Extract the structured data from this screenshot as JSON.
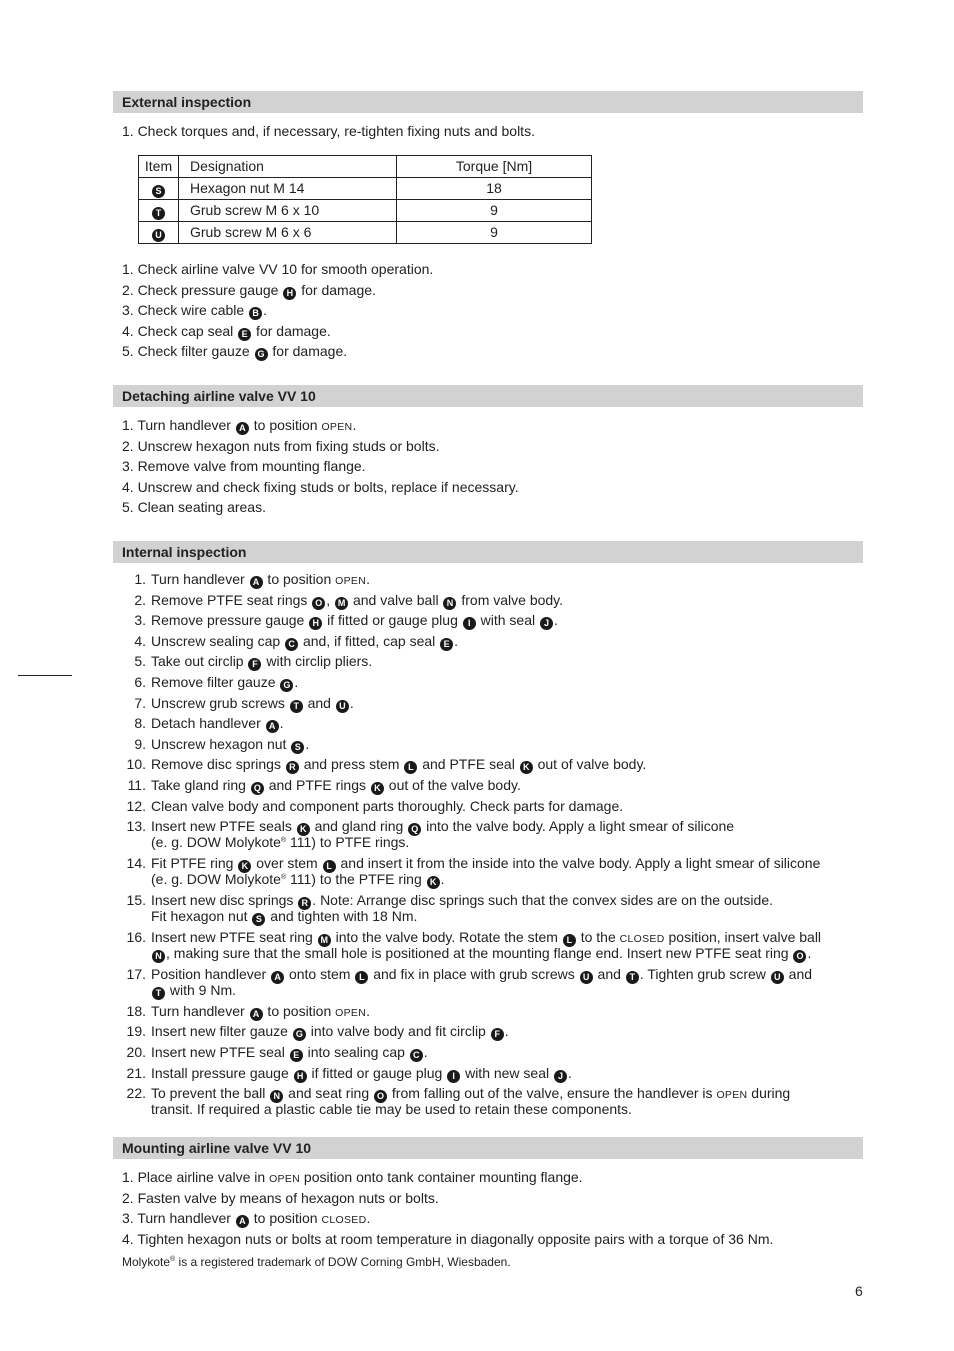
{
  "page_number": "6",
  "sections": {
    "external": {
      "title": "External inspection",
      "intro": "1. Check torques and, if necessary, re-tighten fixing nuts and bolts.",
      "table": {
        "headers": [
          "Item",
          "Designation",
          "Torque [Nm]"
        ],
        "rows": [
          {
            "item": "S",
            "designation": "Hexagon nut M 14",
            "torque": "18"
          },
          {
            "item": "T",
            "designation": "Grub screw M 6 x 10",
            "torque": "9"
          },
          {
            "item": "U",
            "designation": "Grub screw M 6 x 6",
            "torque": "9"
          }
        ]
      },
      "steps": [
        "1. Check airline valve VV 10 for smooth operation.",
        "2. Check pressure gauge {H} for damage.",
        "3. Check wire cable {B}.",
        "4. Check cap seal {E} for damage.",
        "5. Check filter gauze {G} for damage."
      ]
    },
    "detaching": {
      "title": "Detaching airline valve VV 10",
      "steps": [
        "1. Turn handlever {A} to position [[OPEN]].",
        "2. Unscrew hexagon nuts from fixing studs or bolts.",
        "3. Remove valve from mounting flange.",
        "4. Unscrew and check fixing studs or bolts, replace if necessary.",
        "5. Clean seating areas."
      ]
    },
    "internal": {
      "title": "Internal inspection",
      "steps": [
        {
          "n": "1.",
          "lines": [
            "Turn handlever {A} to position [[OPEN]]."
          ]
        },
        {
          "n": "2.",
          "lines": [
            "Remove PTFE seat rings {O}, {M} and valve ball {N} from valve body."
          ]
        },
        {
          "n": "3.",
          "lines": [
            "Remove pressure gauge {H} if fitted or gauge plug {I}  with seal {J}."
          ]
        },
        {
          "n": "4.",
          "lines": [
            "Unscrew sealing cap {C} and, if fitted, cap seal {E}."
          ]
        },
        {
          "n": "5.",
          "lines": [
            "Take out circlip {F} with circlip pliers."
          ]
        },
        {
          "n": "6.",
          "lines": [
            "Remove filter gauze {G}."
          ]
        },
        {
          "n": "7.",
          "lines": [
            "Unscrew grub screws {T} and {U}."
          ]
        },
        {
          "n": "8.",
          "lines": [
            "Detach handlever {A}."
          ]
        },
        {
          "n": "9.",
          "lines": [
            "Unscrew hexagon nut {S}."
          ]
        },
        {
          "n": "10.",
          "lines": [
            "Remove disc springs {R} and press stem {L} and PTFE seal {K} out of valve body."
          ]
        },
        {
          "n": "11.",
          "lines": [
            "Take gland ring {Q} and PTFE rings {K} out of the valve body."
          ]
        },
        {
          "n": "12.",
          "lines": [
            "Clean valve body and component parts thoroughly. Check parts for damage."
          ]
        },
        {
          "n": "13.",
          "lines": [
            "Insert new PTFE seals {K} and gland ring {Q} into the valve body. Apply a light smear of silicone",
            "(e. g. DOW Molykote^® 111) to PTFE rings."
          ]
        },
        {
          "n": "14.",
          "lines": [
            "Fit PTFE ring {K} over stem {L} and insert it from the inside into the valve body.  Apply a light smear of silicone",
            "(e. g. DOW Molykote^® 111) to the PTFE ring {K}."
          ]
        },
        {
          "n": "15.",
          "lines": [
            "Insert new disc springs {R}. Note: Arrange disc springs such that the convex sides are on the outside.",
            "Fit hexagon nut {S} and tighten with 18 Nm."
          ]
        },
        {
          "n": "16.",
          "lines": [
            "Insert new PTFE seat ring {M} into the valve body. Rotate the stem {L} to the [[CLOSED]] position, insert valve ball",
            "{N}, making sure that the small hole is positioned at the mounting flange end. Insert new PTFE seat ring {O}."
          ]
        },
        {
          "n": "17.",
          "lines": [
            "Position handlever {A} onto stem {L} and fix in place with grub screws {U} and {T}. Tighten grub screw {U} and",
            "{T} with 9 Nm."
          ]
        },
        {
          "n": "18.",
          "lines": [
            "Turn handlever {A} to position [[OPEN]]."
          ]
        },
        {
          "n": "19.",
          "lines": [
            "Insert new filter gauze {G} into valve body and fit circlip {F}."
          ]
        },
        {
          "n": "20.",
          "lines": [
            "Insert new PTFE seal {E} into sealing cap {C}."
          ]
        },
        {
          "n": "21.",
          "lines": [
            "Install pressure gauge {H} if fitted or gauge plug {I} with new seal {J}."
          ]
        },
        {
          "n": "22.",
          "lines": [
            "To prevent the ball {N} and seat ring {O} from falling out of the valve, ensure the handlever is [[OPEN]] during",
            "transit. If required a plastic cable tie may be used to retain these components."
          ]
        }
      ]
    },
    "mounting": {
      "title": "Mounting airline valve VV 10",
      "steps": [
        "1. Place airline valve in [[OPEN]] position onto tank container mounting flange.",
        "2. Fasten valve by means of hexagon nuts or bolts.",
        "3. Turn handlever {A} to position [[CLOSED]].",
        "4. Tighten hexagon nuts or bolts at room temperature in diagonally opposite pairs with a torque of 36 Nm."
      ],
      "footnote": "Molykote^® is a registered trademark of DOW Corning GmbH, Wiesbaden."
    }
  }
}
